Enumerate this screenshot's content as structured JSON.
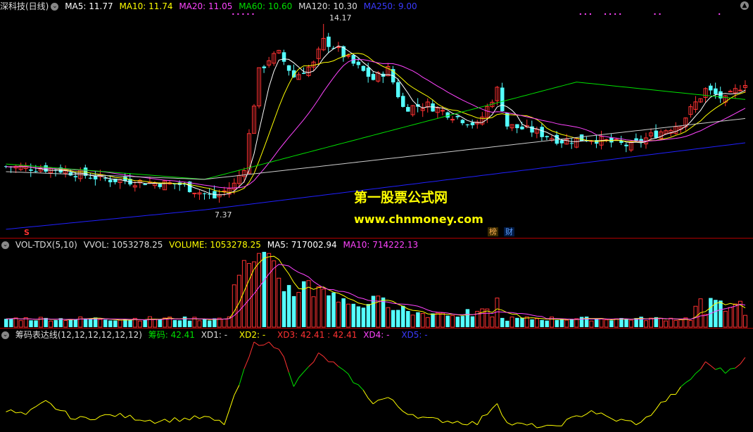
{
  "main_header": {
    "title": "深科技(日线)",
    "ma5": "MA5: 11.77",
    "ma10": "MA10: 11.74",
    "ma20": "MA20: 11.05",
    "ma60": "MA60: 10.60",
    "ma120": "MA120: 10.30",
    "ma250": "MA250: 9.00"
  },
  "annotations": {
    "high": "14.17",
    "low": "7.37"
  },
  "watermark": {
    "line1": "第一股票公式网",
    "line2": "www.chnmoney.com"
  },
  "badges": {
    "bang": "榜",
    "cai": "财",
    "s_marker": "S"
  },
  "vol_header": {
    "name": "VOL-TDX(5,10)",
    "vvol": "VVOL: 1053278.25",
    "volume": "VOLUME: 1053278.25",
    "ma5": "MA5: 717002.94",
    "ma10": "MA10: 714222.13"
  },
  "chip_header": {
    "name": "筹码表达线(12,12,12,12,12,12)",
    "chouma": "筹码: 42.41",
    "xd1": "XD1: -",
    "xd2": "XD2: -",
    "xd3": "XD3: 42.41",
    "xd3b": ": 42.41",
    "xd4": "XD4: -",
    "xd5": "XD5: -"
  },
  "colors": {
    "up": "#ff3232",
    "down": "#54ffff",
    "ma5": "#ffffff",
    "ma10": "#ffff00",
    "ma20": "#ff44ff",
    "ma60": "#00e000",
    "ma120": "#cccccc",
    "ma250": "#2020ff",
    "separator": "#b00000",
    "watermark1": "#ffff00",
    "watermark2": "#ffff00"
  },
  "icons": {
    "collapse": "chevron-circle-icon",
    "scroll_up": "up-arrow-icon"
  }
}
